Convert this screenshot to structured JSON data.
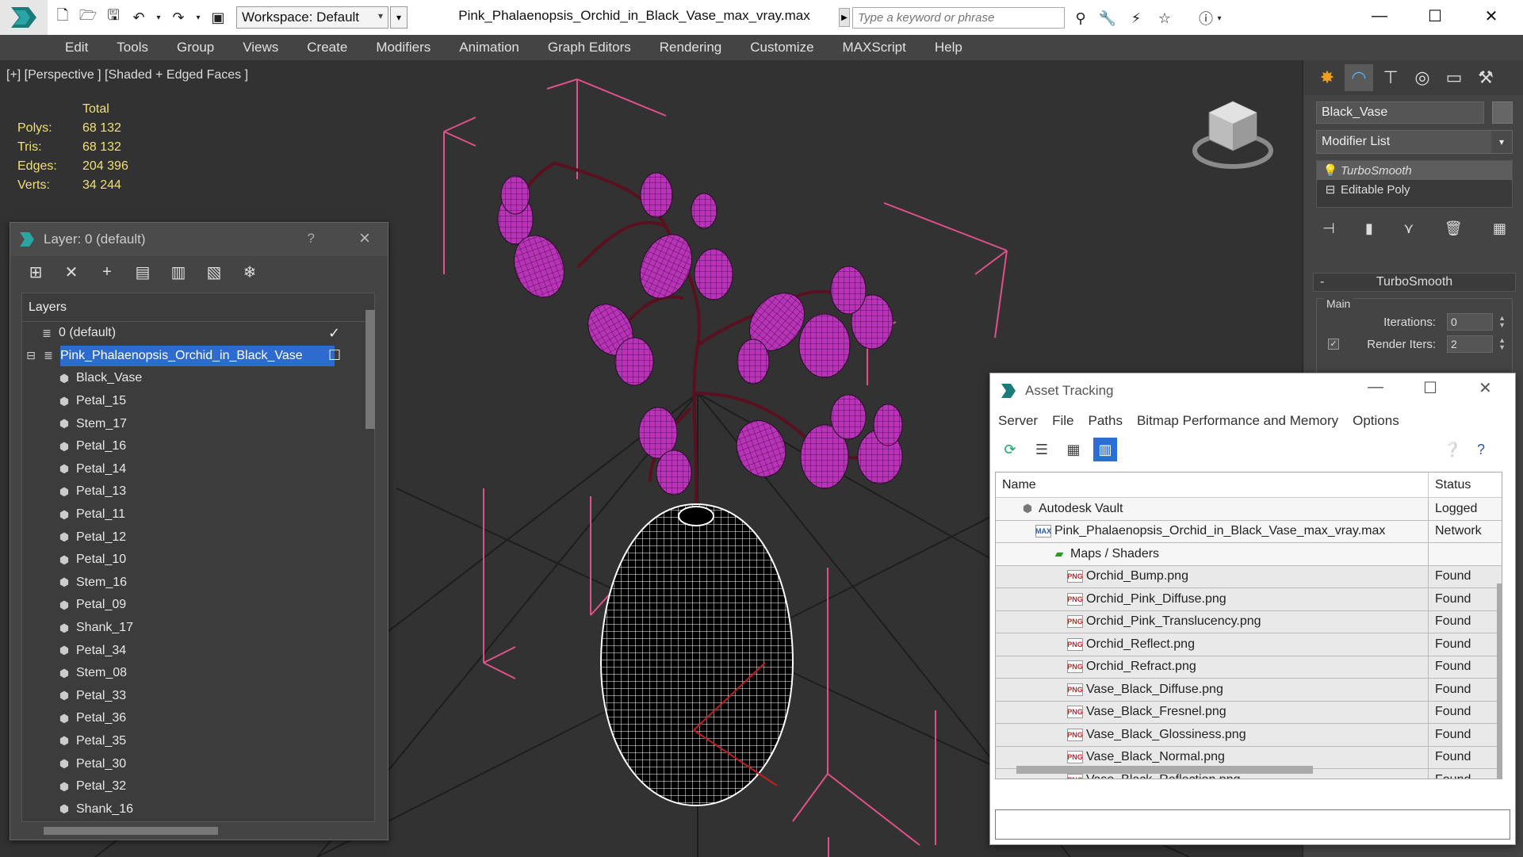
{
  "window": {
    "file_title": "Pink_Phalaenopsis_Orchid_in_Black_Vase_max_vray.max",
    "workspace_label": "Workspace: Default",
    "search_placeholder": "Type a keyword or phrase"
  },
  "menu": [
    "Edit",
    "Tools",
    "Group",
    "Views",
    "Create",
    "Modifiers",
    "Animation",
    "Graph Editors",
    "Rendering",
    "Customize",
    "MAXScript",
    "Help"
  ],
  "viewport": {
    "label": "[+] [Perspective ] [Shaded + Edged Faces ]",
    "stats_header": "Total",
    "stats": [
      {
        "k": "Polys:",
        "v": "68 132"
      },
      {
        "k": "Tris:",
        "v": "68 132"
      },
      {
        "k": "Edges:",
        "v": "204 396"
      },
      {
        "k": "Verts:",
        "v": "34 244"
      }
    ]
  },
  "command_panel": {
    "object_name": "Black_Vase",
    "modifier_list": "Modifier List",
    "stack": [
      {
        "label": "TurboSmooth",
        "selected": true,
        "icon": "bulb-icon"
      },
      {
        "label": "Editable Poly",
        "selected": false,
        "icon": "expand-icon"
      }
    ],
    "rollout_title": "TurboSmooth",
    "group_label": "Main",
    "iterations_label": "Iterations:",
    "iterations_value": "0",
    "render_iters_label": "Render Iters:",
    "render_iters_value": "2"
  },
  "layer_dialog": {
    "title": "Layer: 0 (default)",
    "help": "?",
    "header": "Layers",
    "rows": [
      {
        "name": "0 (default)",
        "level": 0,
        "type": "layer",
        "checked": true,
        "selected": false
      },
      {
        "name": "Pink_Phalaenopsis_Orchid_in_Black_Vase",
        "level": 0,
        "type": "layer",
        "checked": false,
        "selected": true
      },
      {
        "name": "Black_Vase",
        "level": 1,
        "type": "object"
      },
      {
        "name": "Petal_15",
        "level": 1,
        "type": "object"
      },
      {
        "name": "Stem_17",
        "level": 1,
        "type": "object"
      },
      {
        "name": "Petal_16",
        "level": 1,
        "type": "object"
      },
      {
        "name": "Petal_14",
        "level": 1,
        "type": "object"
      },
      {
        "name": "Petal_13",
        "level": 1,
        "type": "object"
      },
      {
        "name": "Petal_11",
        "level": 1,
        "type": "object"
      },
      {
        "name": "Petal_12",
        "level": 1,
        "type": "object"
      },
      {
        "name": "Petal_10",
        "level": 1,
        "type": "object"
      },
      {
        "name": "Stem_16",
        "level": 1,
        "type": "object"
      },
      {
        "name": "Petal_09",
        "level": 1,
        "type": "object"
      },
      {
        "name": "Shank_17",
        "level": 1,
        "type": "object"
      },
      {
        "name": "Petal_34",
        "level": 1,
        "type": "object"
      },
      {
        "name": "Stem_08",
        "level": 1,
        "type": "object"
      },
      {
        "name": "Petal_33",
        "level": 1,
        "type": "object"
      },
      {
        "name": "Petal_36",
        "level": 1,
        "type": "object"
      },
      {
        "name": "Petal_35",
        "level": 1,
        "type": "object"
      },
      {
        "name": "Petal_30",
        "level": 1,
        "type": "object"
      },
      {
        "name": "Petal_32",
        "level": 1,
        "type": "object"
      },
      {
        "name": "Shank_16",
        "level": 1,
        "type": "object"
      }
    ]
  },
  "asset_dialog": {
    "title": "Asset Tracking",
    "menu": [
      "Server",
      "File",
      "Paths",
      "Bitmap Performance and Memory",
      "Options"
    ],
    "col_name": "Name",
    "col_status": "Status",
    "rows": [
      {
        "name": "Autodesk Vault",
        "status": "Logged",
        "level": 1,
        "icon": "vault-icon"
      },
      {
        "name": "Pink_Phalaenopsis_Orchid_in_Black_Vase_max_vray.max",
        "status": "Network",
        "level": 2,
        "icon": "max-file-icon"
      },
      {
        "name": "Maps / Shaders",
        "status": "",
        "level": 3,
        "icon": "maps-icon"
      },
      {
        "name": "Orchid_Bump.png",
        "status": "Found",
        "level": 4,
        "icon": "png-icon"
      },
      {
        "name": "Orchid_Pink_Diffuse.png",
        "status": "Found",
        "level": 4,
        "icon": "png-icon"
      },
      {
        "name": "Orchid_Pink_Translucency.png",
        "status": "Found",
        "level": 4,
        "icon": "png-icon"
      },
      {
        "name": "Orchid_Reflect.png",
        "status": "Found",
        "level": 4,
        "icon": "png-icon"
      },
      {
        "name": "Orchid_Refract.png",
        "status": "Found",
        "level": 4,
        "icon": "png-icon"
      },
      {
        "name": "Vase_Black_Diffuse.png",
        "status": "Found",
        "level": 4,
        "icon": "png-icon"
      },
      {
        "name": "Vase_Black_Fresnel.png",
        "status": "Found",
        "level": 4,
        "icon": "png-icon"
      },
      {
        "name": "Vase_Black_Glossiness.png",
        "status": "Found",
        "level": 4,
        "icon": "png-icon"
      },
      {
        "name": "Vase_Black_Normal.png",
        "status": "Found",
        "level": 4,
        "icon": "png-icon"
      },
      {
        "name": "Vase_Black_Reflection.png",
        "status": "Found",
        "level": 4,
        "icon": "png-icon"
      }
    ]
  },
  "colors": {
    "accent_blue": "#2e6bcf",
    "stats_yellow": "#f0e070",
    "petal_pink": "#c040c0",
    "bbox_pink": "#e0508a"
  }
}
